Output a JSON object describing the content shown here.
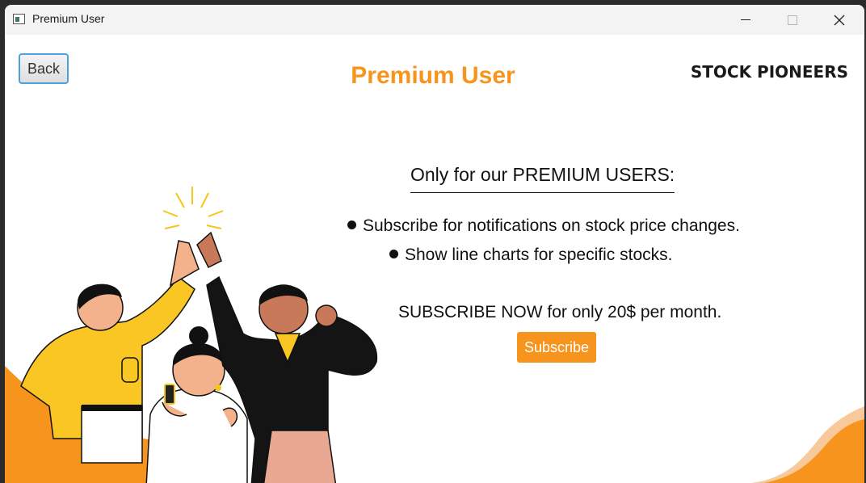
{
  "window": {
    "title": "Premium User"
  },
  "header": {
    "back_label": "Back",
    "page_title": "Premium User",
    "brand": "STOCK PIONEERS"
  },
  "main": {
    "heading": "Only for our PREMIUM USERS:",
    "features": [
      "Subscribe for notifications on stock price changes.",
      "Show line charts for specific stocks."
    ],
    "offer_text": "SUBSCRIBE NOW for only 20$ per month.",
    "subscribe_label": "Subscribe"
  },
  "colors": {
    "accent": "#f7941d",
    "focus_border": "#4aa3df"
  }
}
